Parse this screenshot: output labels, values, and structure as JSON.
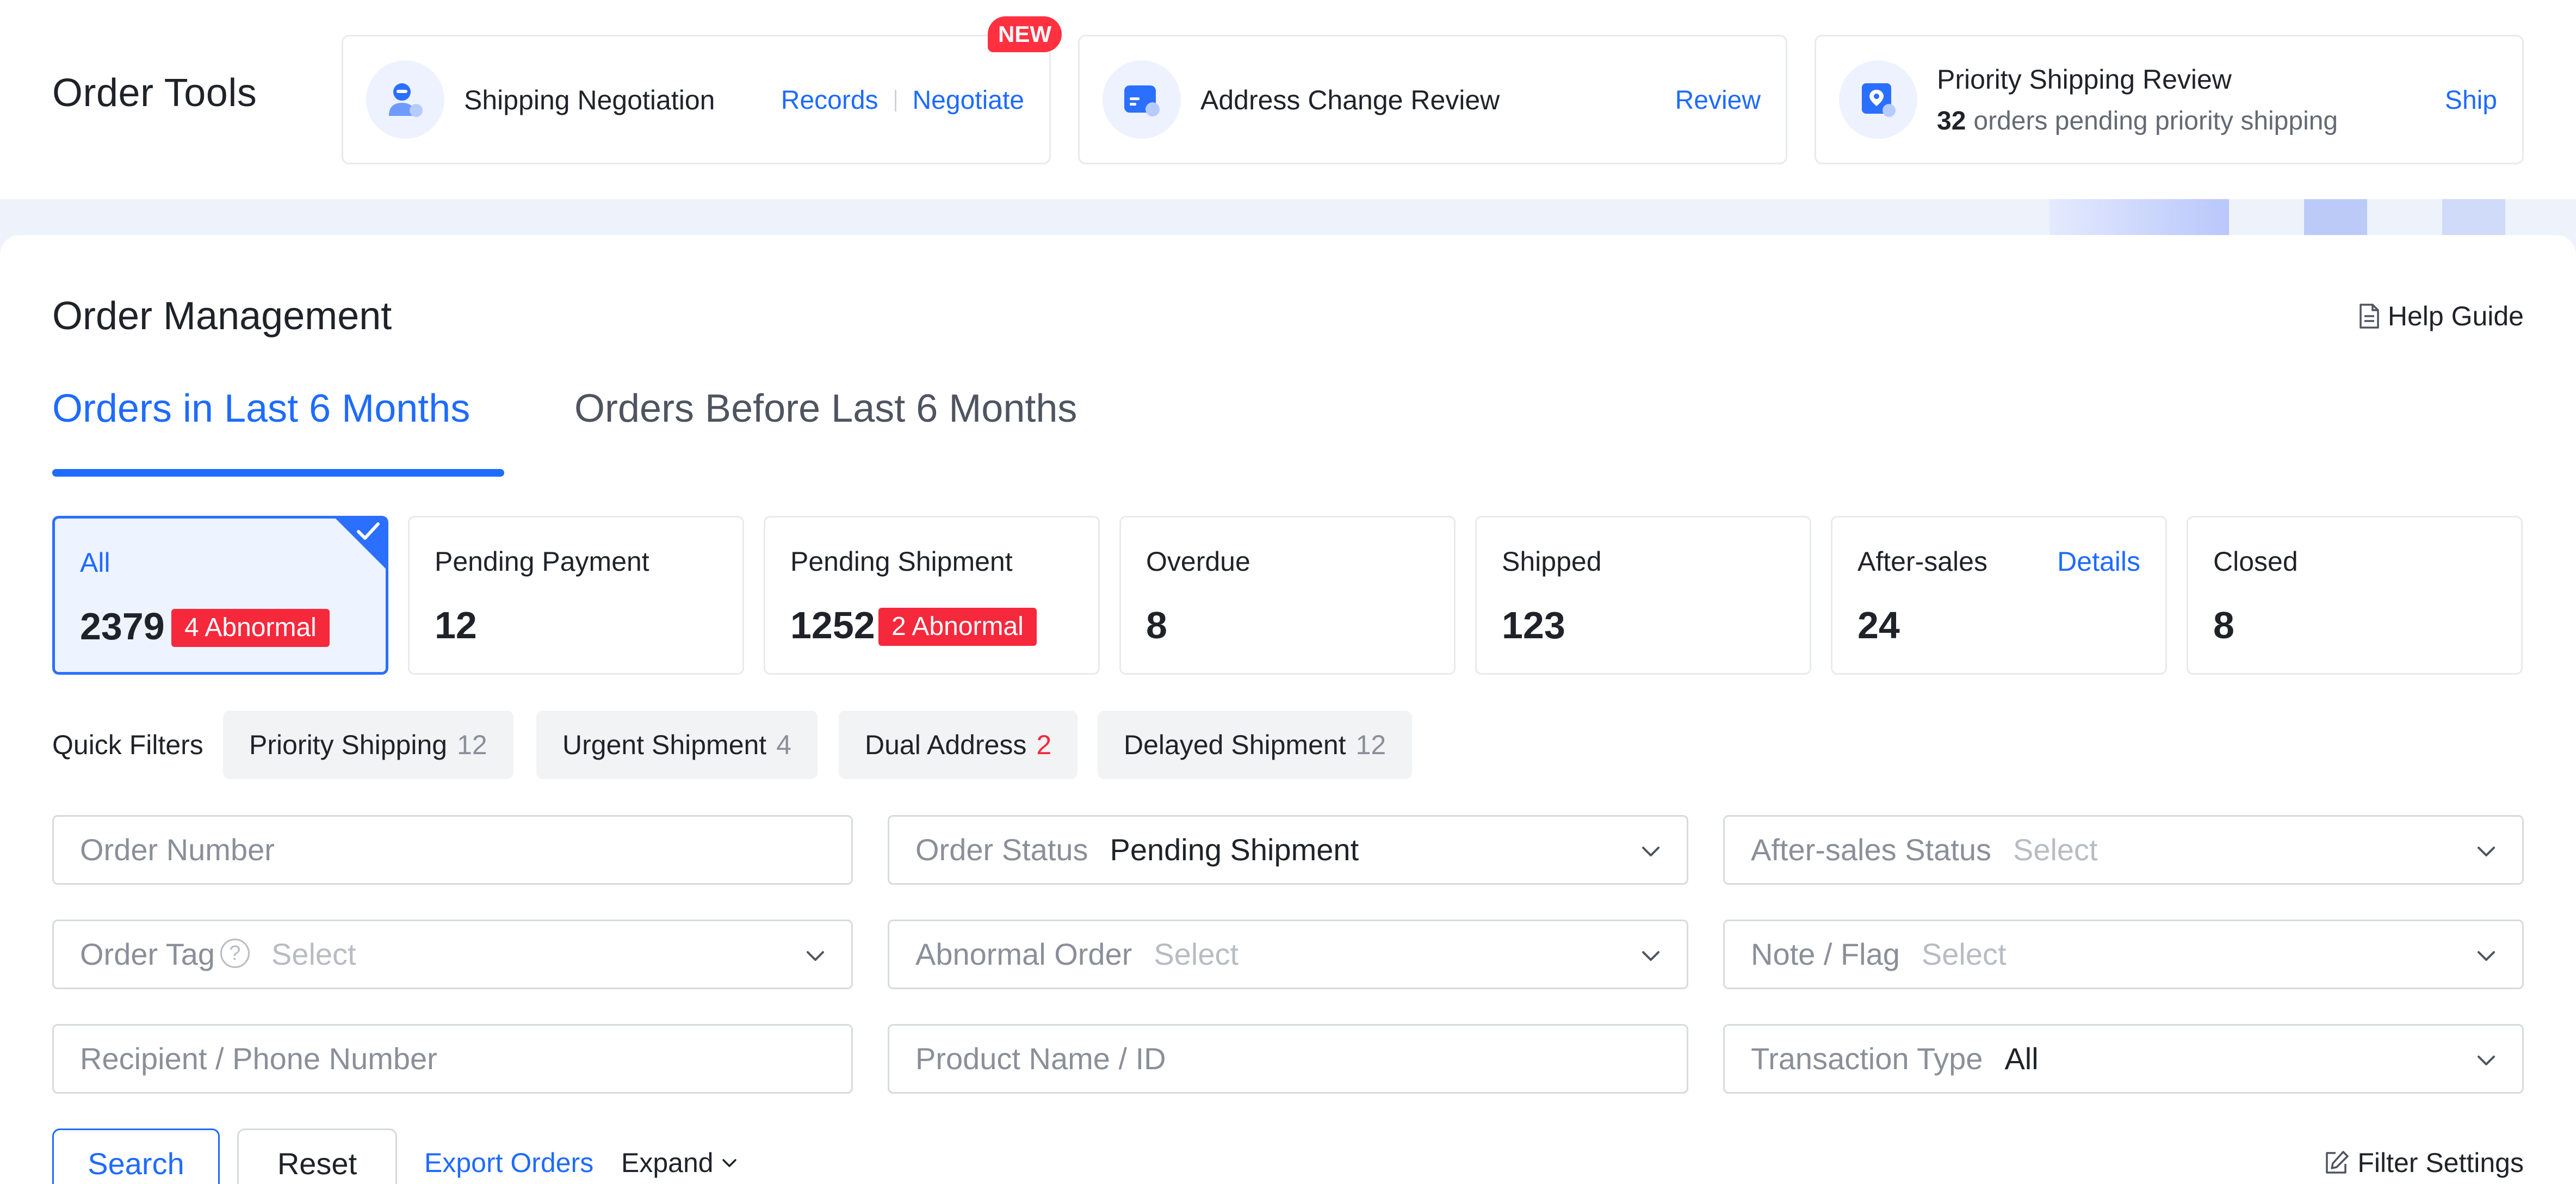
{
  "colors": {
    "accent": "#1e6bff",
    "danger": "#f5283c",
    "muted": "#8a8f99"
  },
  "tools": {
    "title": "Order Tools",
    "new_badge": "NEW",
    "items": [
      {
        "name": "Shipping Negotiation",
        "links": [
          "Records",
          "Negotiate"
        ],
        "icon": "agent-icon"
      },
      {
        "name": "Address Change Review",
        "links": [
          "Review"
        ],
        "icon": "address-card-icon"
      },
      {
        "name": "Priority Shipping Review",
        "count": "32",
        "sub": "orders pending priority shipping",
        "links": [
          "Ship"
        ],
        "icon": "location-pin-icon"
      }
    ]
  },
  "main": {
    "title": "Order Management",
    "help": "Help Guide",
    "tabs": [
      "Orders in Last 6 Months",
      "Orders Before Last 6 Months"
    ],
    "stats": [
      {
        "label": "All",
        "value": "2379",
        "abnormal": "4 Abnormal"
      },
      {
        "label": "Pending Payment",
        "value": "12"
      },
      {
        "label": "Pending Shipment",
        "value": "1252",
        "abnormal": "2 Abnormal"
      },
      {
        "label": "Overdue",
        "value": "8"
      },
      {
        "label": "Shipped",
        "value": "123"
      },
      {
        "label": "After-sales",
        "value": "24",
        "link": "Details"
      },
      {
        "label": "Closed",
        "value": "8"
      }
    ],
    "quick_filters": {
      "label": "Quick Filters",
      "chips": [
        {
          "label": "Priority Shipping",
          "count": "12"
        },
        {
          "label": "Urgent Shipment",
          "count": "4"
        },
        {
          "label": "Dual Address",
          "count": "2"
        },
        {
          "label": "Delayed Shipment",
          "count": "12"
        }
      ]
    },
    "form": {
      "order_number": "Order Number",
      "order_status": {
        "label": "Order Status",
        "value": "Pending Shipment"
      },
      "after_sales": {
        "label": "After-sales Status",
        "placeholder": "Select"
      },
      "order_tag": {
        "label": "Order Tag",
        "placeholder": "Select",
        "help": "?"
      },
      "abnormal": {
        "label": "Abnormal Order",
        "placeholder": "Select"
      },
      "note_flag": {
        "label": "Note / Flag",
        "placeholder": "Select"
      },
      "recipient": "Recipient / Phone Number",
      "product": "Product Name / ID",
      "transaction": {
        "label": "Transaction Type",
        "value": "All"
      }
    },
    "actions": {
      "search": "Search",
      "reset": "Reset",
      "export": "Export Orders",
      "expand": "Expand",
      "filter_settings": "Filter Settings"
    }
  }
}
